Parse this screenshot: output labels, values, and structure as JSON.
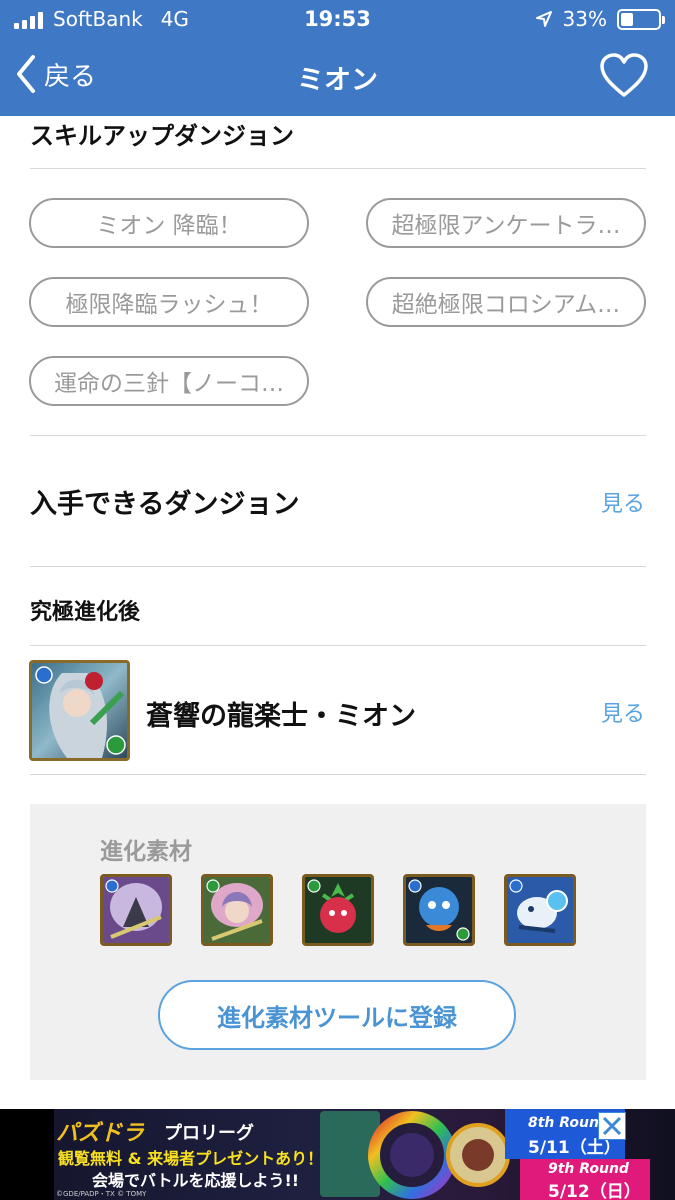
{
  "status_bar": {
    "carrier": "SoftBank",
    "network": "4G",
    "time": "19:53",
    "battery_percent": "33%",
    "battery_level": 0.33
  },
  "nav": {
    "back_label": "戻る",
    "title": "ミオン",
    "favorite_icon": "heart-outline-icon"
  },
  "skill_up": {
    "heading": "スキルアップダンジョン",
    "chips": [
      "ミオン 降臨！",
      "超極限アンケートラ…",
      "極限降臨ラッシュ！",
      "超絶極限コロシアム…",
      "運命の三針【ノーコ…"
    ]
  },
  "dungeons": {
    "heading": "入手できるダンジョン",
    "see_label": "見る"
  },
  "ultimate": {
    "heading": "究極進化後",
    "monster_name": "蒼響の龍楽士・ミオン",
    "see_label": "見る"
  },
  "materials": {
    "label": "進化素材",
    "icons": [
      "material-icon-1",
      "material-icon-2",
      "material-icon-3",
      "material-icon-4",
      "material-icon-5"
    ],
    "register_button": "進化素材ツールに登録"
  },
  "ad": {
    "logo_text": "パズドラ",
    "league": "プロリーグ",
    "line1": "観覧無料 & 来場者プレゼントあり！",
    "line2": "会場でバトルを応援しよう!!",
    "copyright": "©GDE/PADP・TX © TOMY",
    "round1": "8th Round",
    "date1": "5/11（土）",
    "round2": "9th Round",
    "date2": "5/12（日）",
    "close_icon": "close-icon"
  },
  "colors": {
    "header_bg": "#3f78c4",
    "link_blue": "#5aa3e0",
    "chip_gray": "#9a9a9a"
  }
}
